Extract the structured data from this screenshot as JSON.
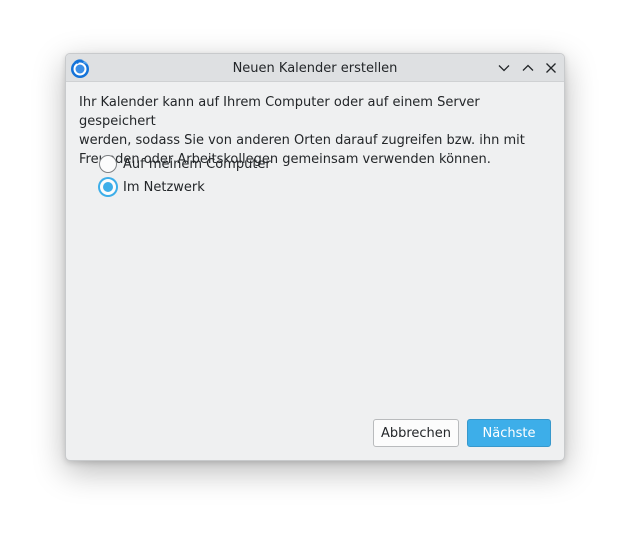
{
  "window": {
    "title": "Neuen Kalender erstellen",
    "controls": {
      "minimize_icon": "chevron-down-icon",
      "maximize_icon": "chevron-up-icon",
      "close_icon": "close-icon"
    },
    "app_icon": "thunderbird-icon"
  },
  "content": {
    "description_lines": [
      "Ihr Kalender kann auf Ihrem Computer oder auf einem Server gespeichert",
      "werden, sodass Sie von anderen Orten darauf zugreifen bzw. ihn mit",
      "Freunden oder Arbeitskollegen gemeinsam verwenden können."
    ],
    "options": [
      {
        "label": "Auf meinem Computer",
        "selected": false
      },
      {
        "label": "Im Netzwerk",
        "selected": true
      }
    ]
  },
  "buttons": {
    "cancel_label": "Abbrechen",
    "next_label": "Nächste"
  },
  "colors": {
    "accent": "#3daee9",
    "window_bg": "#eff0f1",
    "titlebar_bg": "#dee0e2"
  }
}
